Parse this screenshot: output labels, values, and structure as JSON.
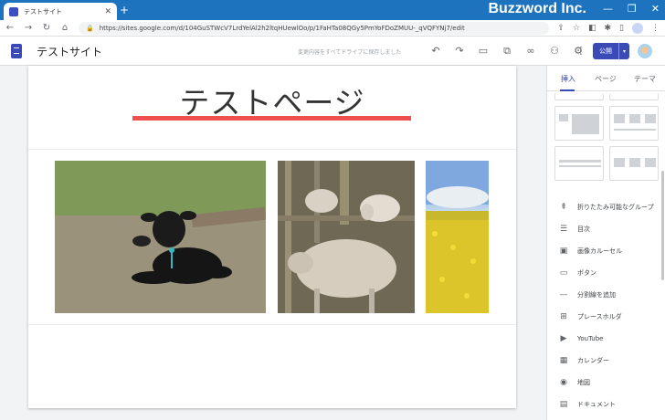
{
  "browser": {
    "tab_title": "テストサイト",
    "tab_close": "✕",
    "new_tab": "+",
    "brand_watermark": "Buzzword Inc.",
    "window_controls": [
      "—",
      "❐",
      "✕"
    ],
    "url": "https://sites.google.com/d/104GuSTWcV7LrdYelAl2h2ltqHUewlOo/p/1FaHTa08QGy5PmYoFDoZMUU-_qVQFYNj7/edit",
    "nav": {
      "back": "←",
      "forward": "→",
      "reload": "↻",
      "home": "⌂"
    },
    "lock_icon": "🔒"
  },
  "app": {
    "site_name": "テストサイト",
    "saved_note": "変更内容をすべてドライブに保存しました",
    "publish_label": "公開",
    "publish_caret": "▾",
    "accent": "#3b4bb5"
  },
  "page": {
    "title": "テストページ",
    "underline_color": "#ee5050"
  },
  "panel": {
    "tabs": [
      "挿入",
      "ページ",
      "テーマ"
    ],
    "active_tab": "挿入",
    "items": [
      {
        "icon": "collapsible-group-icon",
        "glyph": "⇞",
        "label": "折りたたみ可能なグループ"
      },
      {
        "icon": "toc-icon",
        "glyph": "☰",
        "label": "目次"
      },
      {
        "icon": "carousel-icon",
        "glyph": "▣",
        "label": "画像カルーセル"
      },
      {
        "icon": "button-icon",
        "glyph": "▭",
        "label": "ボタン"
      },
      {
        "icon": "divider-icon",
        "glyph": "—",
        "label": "分割線を追加"
      },
      {
        "icon": "placeholder-icon",
        "glyph": "⊞",
        "label": "プレースホルダ"
      },
      {
        "icon": "youtube-icon",
        "glyph": "▶",
        "label": "YouTube"
      },
      {
        "icon": "calendar-icon",
        "glyph": "▦",
        "label": "カレンダー"
      },
      {
        "icon": "map-icon",
        "glyph": "◉",
        "label": "地図"
      },
      {
        "icon": "docs-icon",
        "glyph": "▤",
        "label": "ドキュメント"
      }
    ]
  }
}
